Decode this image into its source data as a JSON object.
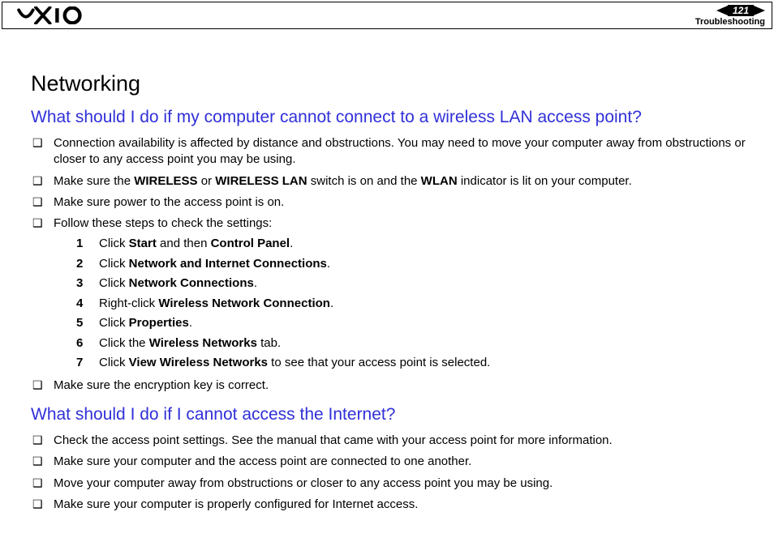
{
  "header": {
    "page_number": "121",
    "section": "Troubleshooting"
  },
  "title": "Networking",
  "q1": {
    "heading": "What should I do if my computer cannot connect to a wireless LAN access point?",
    "items": [
      "Connection availability is affected by distance and obstructions. You may need to move your computer away from obstructions or closer to any access point you may be using.",
      "Make sure the WIRELESS or WIRELESS LAN switch is on and the WLAN indicator is lit on your computer.",
      "Make sure power to the access point is on.",
      "Follow these steps to check the settings:",
      "Make sure the encryption key is correct."
    ],
    "steps": [
      "Click Start and then Control Panel.",
      "Click Network and Internet Connections.",
      "Click Network Connections.",
      "Right-click Wireless Network Connection.",
      "Click Properties.",
      "Click the Wireless Networks tab.",
      "Click View Wireless Networks to see that your access point is selected."
    ],
    "step_nums": [
      "1",
      "2",
      "3",
      "4",
      "5",
      "6",
      "7"
    ]
  },
  "q2": {
    "heading": "What should I do if I cannot access the Internet?",
    "items": [
      "Check the access point settings. See the manual that came with your access point for more information.",
      "Make sure your computer and the access point are connected to one another.",
      "Move your computer away from obstructions or closer to any access point you may be using.",
      "Make sure your computer is properly configured for Internet access."
    ]
  }
}
